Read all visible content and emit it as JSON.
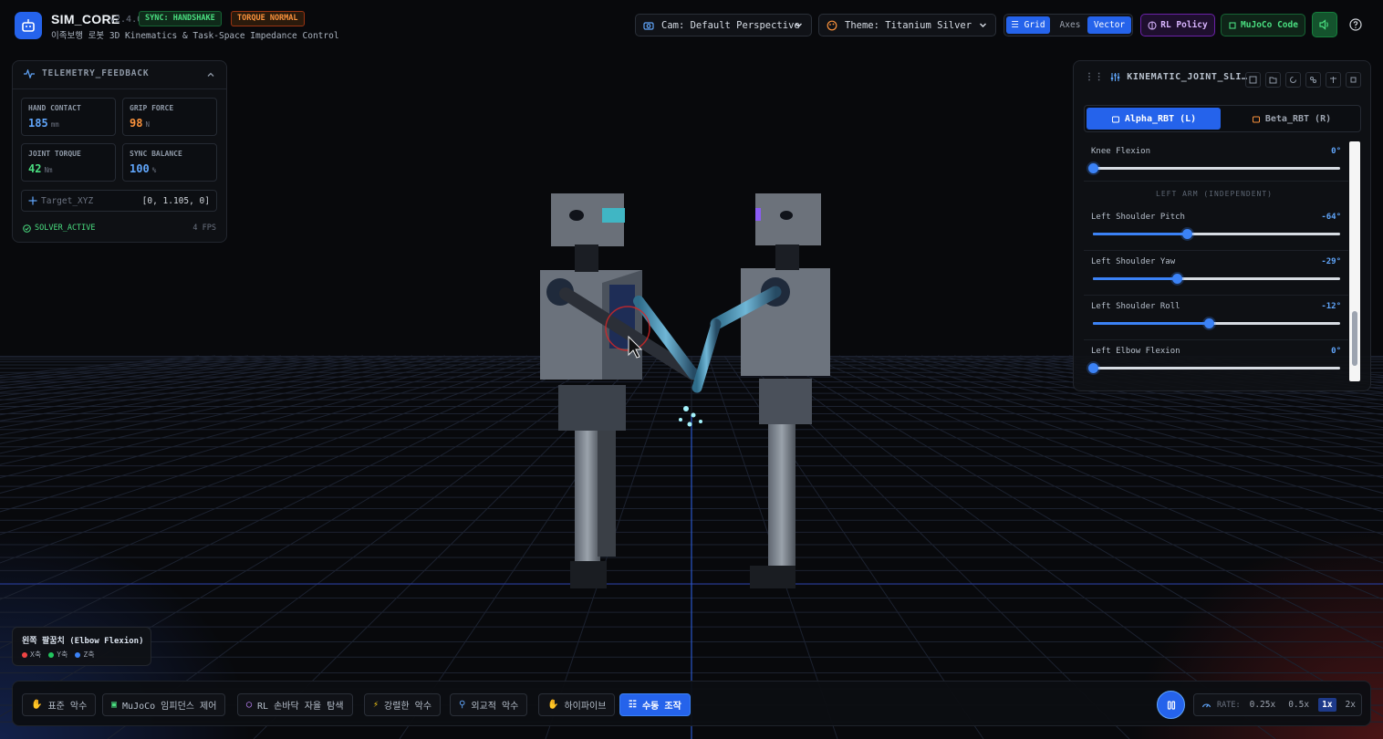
{
  "header": {
    "title": "SIM_CORE",
    "version": "v2.4.0",
    "badge_sync": "SYNC: HANDSHAKE",
    "badge_torque": "TORQUE NORMAL",
    "subtitle": "이족보행 로봇 3D Kinematics & Task-Space Impedance Control",
    "camera": "Cam: Default Perspective",
    "theme": "Theme: Titanium Silver",
    "view_toggles": {
      "grid": "Grid",
      "axes": "Axes",
      "vector": "Vector"
    },
    "rl_policy": "RL Policy",
    "mujoco_code": "MuJoCo Code"
  },
  "telemetry": {
    "title": "TELEMETRY_FEEDBACK",
    "hand_contact": {
      "label": "HAND CONTACT",
      "value": "185",
      "unit": "mm"
    },
    "grip_force": {
      "label": "GRIP FORCE",
      "value": "98",
      "unit": "N"
    },
    "joint_torque": {
      "label": "JOINT TORQUE",
      "value": "42",
      "unit": "Nm"
    },
    "sync_balance": {
      "label": "SYNC BALANCE",
      "value": "100",
      "unit": "%"
    },
    "target_label": "Target_XYZ",
    "target_value": "[0, 1.105, 0]",
    "solver": "SOLVER_ACTIVE",
    "fps": "4 FPS"
  },
  "joint_panel": {
    "title": "KINEMATIC_JOINT_SLI…",
    "tab_alpha": "Alpha_RBT (L)",
    "tab_beta": "Beta_RBT (R)",
    "section_left_arm": "LEFT ARM (INDEPENDENT)",
    "sliders": [
      {
        "label": "Knee Flexion",
        "value": "0°",
        "level": 0.0
      },
      {
        "label": "Left Shoulder Pitch",
        "value": "-64°",
        "level": 0.38
      },
      {
        "label": "Left Shoulder Yaw",
        "value": "-29°",
        "level": 0.34
      },
      {
        "label": "Left Shoulder Roll",
        "value": "-12°",
        "level": 0.47
      },
      {
        "label": "Left Elbow Flexion",
        "value": "0°",
        "level": 0.0
      }
    ]
  },
  "legend": {
    "title": "왼쪽 팔꿈치 (Elbow Flexion)",
    "x": "X축",
    "y": "Y축",
    "z": "Z축",
    "colors": {
      "x": "#ef4444",
      "y": "#22c55e",
      "z": "#3b82f6"
    }
  },
  "modes": [
    {
      "label": "표준 악수",
      "icon": "hand-icon"
    },
    {
      "label": "MuJoCo 임피던스 제어",
      "icon": "chip-icon"
    },
    {
      "label": "RL 손바닥 자율 탐색",
      "icon": "brain-icon"
    },
    {
      "label": "강렬한 악수",
      "icon": "bolt-icon"
    },
    {
      "label": "외교적 악수",
      "icon": "award-icon"
    },
    {
      "label": "하이파이브",
      "icon": "hand-icon"
    },
    {
      "label": "수동 조작",
      "icon": "sliders-icon",
      "active": true
    }
  ],
  "rate": {
    "label": "RATE:",
    "options": [
      "0.25x",
      "0.5x",
      "1x",
      "2x"
    ],
    "selected": "1x"
  },
  "colors": {
    "accent": "#2563eb",
    "bg": "#08090c"
  }
}
